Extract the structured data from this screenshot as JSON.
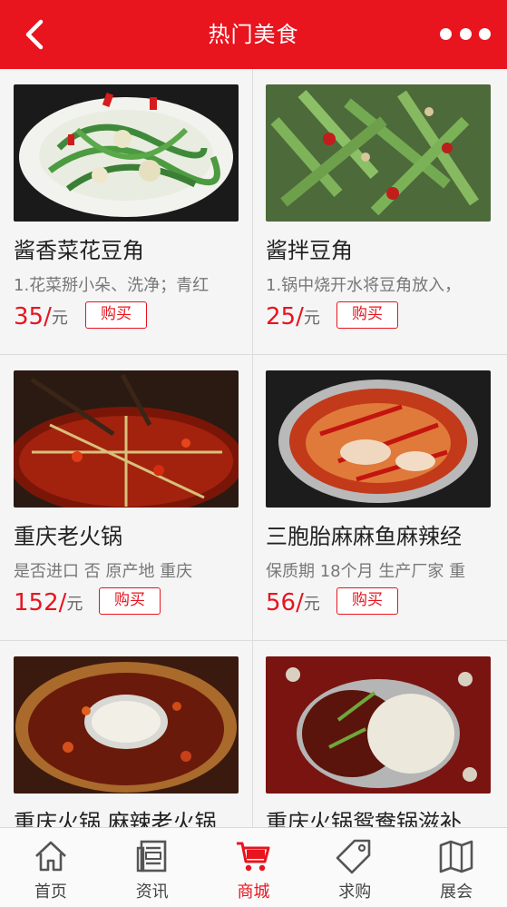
{
  "header": {
    "title": "热门美食"
  },
  "products": [
    {
      "name": "酱香菜花豆角",
      "desc": "1.花菜掰小朵、洗净；青红",
      "price": "35/",
      "unit": "元",
      "buy": "购买"
    },
    {
      "name": "酱拌豆角",
      "desc": "1.锅中烧开水将豆角放入，",
      "price": "25/",
      "unit": "元",
      "buy": "购买"
    },
    {
      "name": "重庆老火锅",
      "desc": "是否进口 否 原产地 重庆",
      "price": "152/",
      "unit": "元",
      "buy": "购买"
    },
    {
      "name": "三胞胎麻麻鱼麻辣经",
      "desc": "保质期 18个月 生产厂家 重",
      "price": "56/",
      "unit": "元",
      "buy": "购买"
    },
    {
      "name": "重庆火锅 麻辣老火锅",
      "desc": "",
      "price": "",
      "unit": "",
      "buy": ""
    },
    {
      "name": "重庆火锅鸳鸯锅滋补",
      "desc": "",
      "price": "",
      "unit": "",
      "buy": ""
    }
  ],
  "tabs": [
    {
      "label": "首页",
      "icon": "home-icon"
    },
    {
      "label": "资讯",
      "icon": "news-icon"
    },
    {
      "label": "商城",
      "icon": "cart-icon",
      "active": true
    },
    {
      "label": "求购",
      "icon": "tag-icon"
    },
    {
      "label": "展会",
      "icon": "map-icon"
    }
  ],
  "colors": {
    "brand": "#e8141e",
    "tab_inactive": "#555555"
  }
}
